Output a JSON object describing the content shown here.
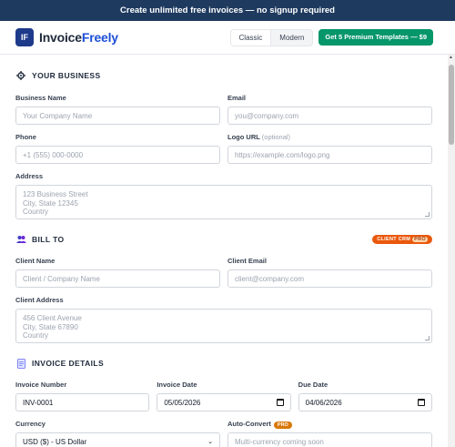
{
  "banner": {
    "text": "Create unlimited free invoices — no signup required"
  },
  "header": {
    "logo_abbr": "IF",
    "logo_part1": "Invoice",
    "logo_part2": "Freely",
    "template_options": [
      "Classic",
      "Modern"
    ],
    "selected_template": "Classic",
    "premium_button": "Get 5 Premium Templates — $9"
  },
  "business": {
    "title": "YOUR BUSINESS",
    "name_label": "Business Name",
    "name_placeholder": "Your Company Name",
    "email_label": "Email",
    "email_placeholder": "you@company.com",
    "phone_label": "Phone",
    "phone_placeholder": "+1 (555) 000-0000",
    "logo_label": "Logo URL",
    "logo_optional": "(optional)",
    "logo_placeholder": "https://example.com/logo.png",
    "address_label": "Address",
    "address_placeholder": "123 Business Street\nCity, State 12345\nCountry"
  },
  "bill_to": {
    "title": "BILL TO",
    "crm_badge": "CLIENT CRM",
    "crm_pro": "PRO",
    "client_name_label": "Client Name",
    "client_name_placeholder": "Client / Company Name",
    "client_email_label": "Client Email",
    "client_email_placeholder": "client@company.com",
    "client_address_label": "Client Address",
    "client_address_placeholder": "456 Client Avenue\nCity, State 67890\nCountry"
  },
  "invoice": {
    "title": "INVOICE DETAILS",
    "number_label": "Invoice Number",
    "number_value": "INV-0001",
    "date_label": "Invoice Date",
    "date_value": "05/05/2026",
    "due_label": "Due Date",
    "due_value": "04/06/2026",
    "currency_label": "Currency",
    "currency_value": "USD ($) - US Dollar",
    "autoconvert_label": "Auto-Convert",
    "autoconvert_pro": "PRO",
    "autoconvert_placeholder": "Multi-currency coming soon"
  }
}
